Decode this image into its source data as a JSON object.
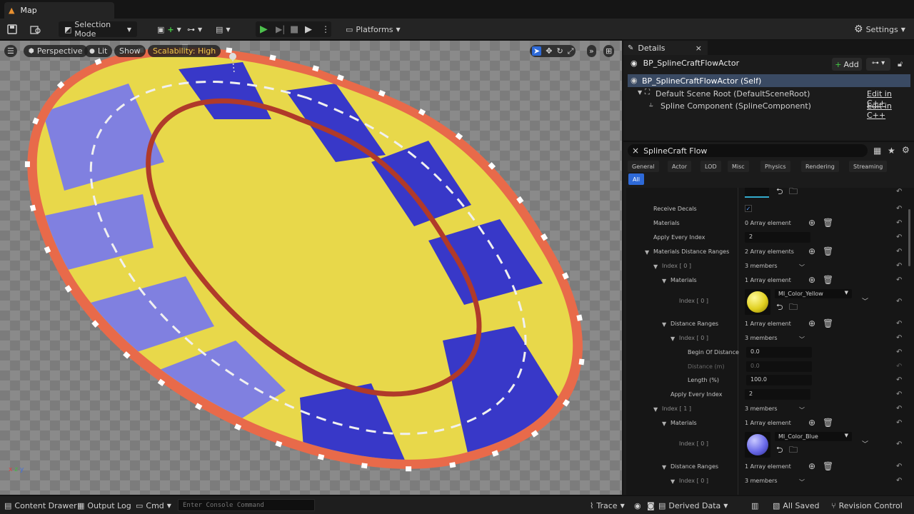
{
  "window": {
    "tab_title": "Map"
  },
  "toolbar": {
    "mode_label": "Selection Mode",
    "platforms_label": "Platforms",
    "settings_label": "Settings"
  },
  "viewport": {
    "view_label": "Perspective",
    "lighting_label": "Lit",
    "show_label": "Show",
    "scalability_label": "Scalability: High"
  },
  "details": {
    "tab_label": "Details",
    "actor_name": "BP_SplineCraftFlowActor",
    "add_label": "Add",
    "components": [
      {
        "label": "BP_SplineCraftFlowActor (Self)",
        "link": ""
      },
      {
        "label": "Default Scene Root (DefaultSceneRoot)",
        "link": "Edit in C++"
      },
      {
        "label": "Spline Component (SplineComponent)",
        "link": "Edit in C++"
      }
    ],
    "search_value": "SplineCraft Flow",
    "filters": [
      "General",
      "Actor",
      "LOD",
      "Misc",
      "Physics",
      "Rendering",
      "Streaming"
    ],
    "filter_active": "All",
    "props": {
      "receive_decals": "Receive Decals",
      "materials": "Materials",
      "materials_val": "0 Array element",
      "apply_every_index": "Apply Every Index",
      "apply_every_index_val": "2",
      "mdr": "Materials Distance Ranges",
      "mdr_val": "2 Array elements",
      "index0": "Index [ 0 ]",
      "index1": "Index [ 1 ]",
      "members3": "3 members",
      "one_array": "1 Array element",
      "mat_yellow": "MI_Color_Yellow",
      "mat_blue": "MI_Color_Blue",
      "distance_ranges": "Distance Ranges",
      "begin_of_distance": "Begin Of Distance",
      "begin_val": "0.0",
      "distance_m": "Distance (m)",
      "distance_val": "0.0",
      "length_pct": "Length (%)",
      "length_val": "100.0"
    }
  },
  "statusbar": {
    "content_drawer": "Content Drawer",
    "output_log": "Output Log",
    "cmd": "Cmd",
    "console_placeholder": "Enter Console Command",
    "trace": "Trace",
    "derived_data": "Derived Data",
    "all_saved": "All Saved",
    "revision_control": "Revision Control"
  },
  "colors": {
    "yellow": "#e8d84a",
    "blue": "#3838c8",
    "lilac": "#8080e0",
    "rim": "#e86a4a",
    "accent": "#2e6ad8",
    "selection": "#3a4a63"
  }
}
